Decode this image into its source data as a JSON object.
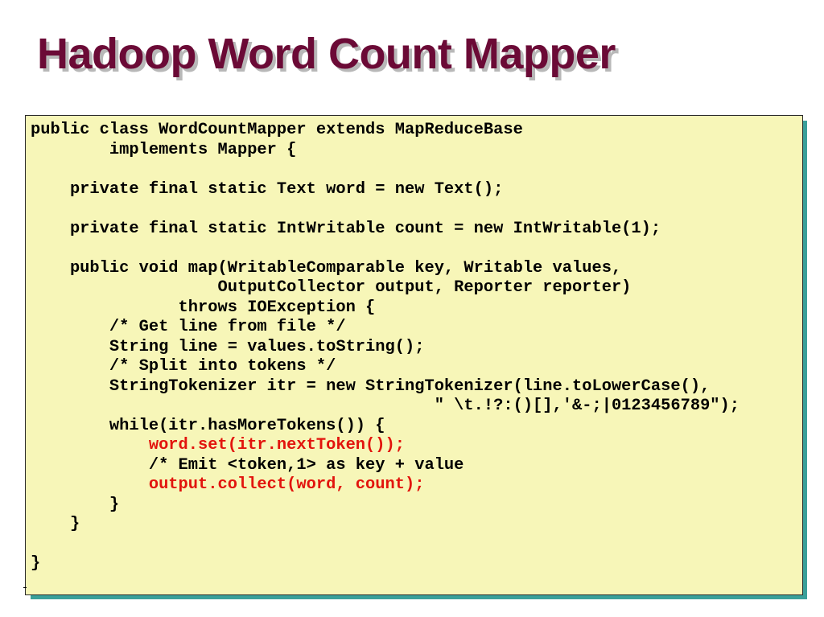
{
  "slide": {
    "title": "Hadoop Word Count Mapper"
  },
  "code": {
    "lines": [
      {
        "text": "public class WordCountMapper extends MapReduceBase",
        "highlight": false
      },
      {
        "text": "        implements Mapper {",
        "highlight": false
      },
      {
        "text": "",
        "highlight": false
      },
      {
        "text": "    private final static Text word = new Text();",
        "highlight": false
      },
      {
        "text": "",
        "highlight": false
      },
      {
        "text": "    private final static IntWritable count = new IntWritable(1);",
        "highlight": false
      },
      {
        "text": "",
        "highlight": false
      },
      {
        "text": "    public void map(WritableComparable key, Writable values,",
        "highlight": false
      },
      {
        "text": "                   OutputCollector output, Reporter reporter)",
        "highlight": false
      },
      {
        "text": "               throws IOException {",
        "highlight": false
      },
      {
        "text": "        /* Get line from file */",
        "highlight": false
      },
      {
        "text": "        String line = values.toString();",
        "highlight": false
      },
      {
        "text": "        /* Split into tokens */",
        "highlight": false
      },
      {
        "text": "        StringTokenizer itr = new StringTokenizer(line.toLowerCase(),",
        "highlight": false
      },
      {
        "text": "                                         \" \\t.!?:()[],'&-;|0123456789\");",
        "highlight": false
      },
      {
        "text": "        while(itr.hasMoreTokens()) {",
        "highlight": false
      },
      {
        "text": "            word.set(itr.nextToken());",
        "highlight": true
      },
      {
        "text": "            /* Emit <token,1> as key + value",
        "highlight": false
      },
      {
        "text": "            output.collect(word, count);",
        "highlight": true
      },
      {
        "text": "        }",
        "highlight": false
      },
      {
        "text": "    }",
        "highlight": false
      },
      {
        "text": "",
        "highlight": false
      },
      {
        "text": "}",
        "highlight": false
      }
    ]
  },
  "colors": {
    "title": "#6b0a36",
    "title_shadow": "#b8b8b8",
    "code_background": "#f7f6b8",
    "code_shadow": "#3aa09a",
    "code_text": "#000000",
    "code_highlight": "#e2140d"
  }
}
